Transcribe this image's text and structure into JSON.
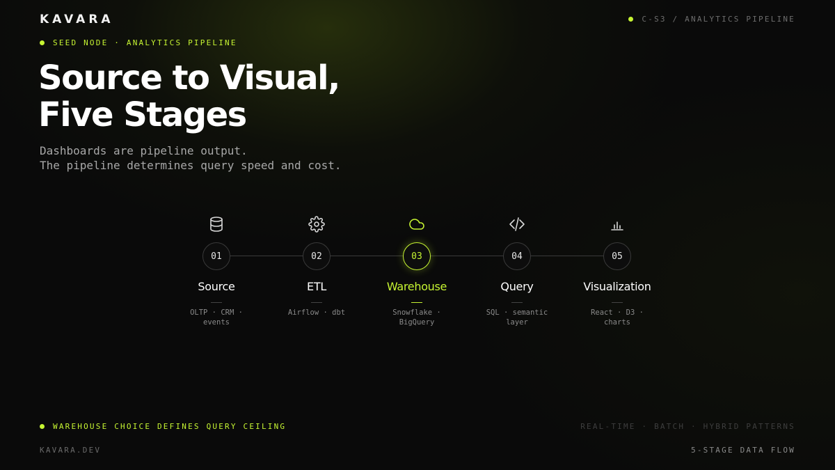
{
  "header": {
    "brand": "KAVARA",
    "tag": "C-S3 / ANALYTICS PIPELINE",
    "eyebrow": "SEED NODE · ANALYTICS PIPELINE"
  },
  "hero": {
    "title_lines": [
      "Source to Visual,",
      "Five Stages"
    ],
    "subtitle_lines": [
      "Dashboards are pipeline output.",
      "The pipeline determines query speed and cost."
    ]
  },
  "stages": [
    {
      "num": "01",
      "name": "Source",
      "desc_lines": [
        "OLTP · CRM ·",
        "events"
      ],
      "icon": "database-icon",
      "active": false
    },
    {
      "num": "02",
      "name": "ETL",
      "desc_lines": [
        "Airflow · dbt"
      ],
      "icon": "gear-icon",
      "active": false
    },
    {
      "num": "03",
      "name": "Warehouse",
      "desc_lines": [
        "Snowflake ·",
        "BigQuery"
      ],
      "icon": "cloud-icon",
      "active": true
    },
    {
      "num": "04",
      "name": "Query",
      "desc_lines": [
        "SQL · semantic",
        "layer"
      ],
      "icon": "code-icon",
      "active": false
    },
    {
      "num": "05",
      "name": "Visualization",
      "desc_lines": [
        "React · D3 ·",
        "charts"
      ],
      "icon": "bar-chart-icon",
      "active": false
    }
  ],
  "footer": {
    "callout": "WAREHOUSE CHOICE DEFINES QUERY CEILING",
    "patterns": "REAL-TIME · BATCH · HYBRID PATTERNS",
    "site": "KAVARA.DEV",
    "flow": "5-STAGE DATA FLOW"
  },
  "colors": {
    "accent": "#c6f432",
    "background": "#0a0a0a",
    "muted": "#8a8a8a"
  }
}
